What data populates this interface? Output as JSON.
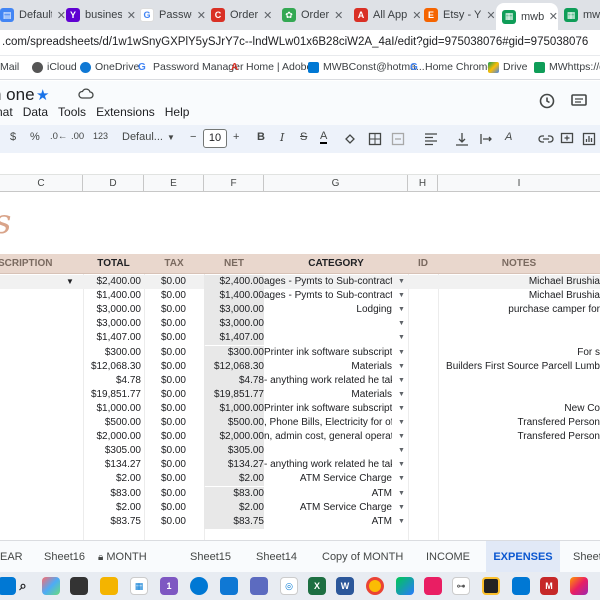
{
  "browser": {
    "tabs": [
      {
        "label": "Default",
        "icon": "google-doc-icon",
        "color": "#4285f4"
      },
      {
        "label": "business",
        "icon": "yahoo-icon",
        "color": "#6001d2"
      },
      {
        "label": "Passwo",
        "icon": "google-icon",
        "color": "#ffffff"
      },
      {
        "label": "Order",
        "icon": "order-icon",
        "color": "#d93025"
      },
      {
        "label": "Order",
        "icon": "leaf-icon",
        "color": "#34a853"
      },
      {
        "label": "All App",
        "icon": "adobe-icon",
        "color": "#d93025"
      },
      {
        "label": "Etsy - Y",
        "icon": "etsy-icon",
        "color": "#f56400"
      },
      {
        "label": "mwb b",
        "icon": "sheets-icon",
        "color": "#0f9d58"
      },
      {
        "label": "mwb",
        "icon": "sheets-icon",
        "color": "#0f9d58"
      }
    ],
    "url": ".com/spreadsheets/d/1w1wSnyGXPlY5ySJrY7c--lndWLw01x6B28ciW2A_4aI/edit?gid=975038076#gid=975038076",
    "bookmarks": [
      {
        "label": "Mail",
        "icon": "mail-icon"
      },
      {
        "label": "iCloud",
        "icon": "apple-icon"
      },
      {
        "label": "OneDrive",
        "icon": "onedrive-icon"
      },
      {
        "label": "Password Manager",
        "icon": "google-icon"
      },
      {
        "label": "Home | Adobe",
        "icon": "adobe-icon"
      },
      {
        "label": "MWBConst@hotma...",
        "icon": "outlook-icon"
      },
      {
        "label": "Home Chrome",
        "icon": "google-icon"
      },
      {
        "label": "Drive",
        "icon": "drive-icon"
      },
      {
        "label": "MWhttps://doc",
        "icon": "sheets-icon"
      }
    ]
  },
  "sheets": {
    "title": "n one",
    "menus": [
      "nat",
      "Data",
      "Tools",
      "Extensions",
      "Help"
    ],
    "toolbar": {
      "currency": "$",
      "percent": "%",
      "dec_decrease": ".0←",
      "dec_increase": ".00",
      "format_123": "123",
      "font": "Defaul...",
      "minus": "−",
      "font_size": "10",
      "plus": "+",
      "bold": "B",
      "italic": "I",
      "strike": "S",
      "text_color": "A"
    },
    "columns": [
      "C",
      "D",
      "E",
      "F",
      "G",
      "H",
      "I"
    ],
    "header_row": {
      "description": "SCRIPTION",
      "total": "TOTAL",
      "tax": "TAX",
      "net": "NET",
      "category": "CATEGORY",
      "id": "ID",
      "notes": "NOTES"
    },
    "rows": [
      {
        "total": "$2,400.00",
        "tax": "$0.00",
        "net": "$2,400.00",
        "category": "ages - Pymts to Sub-contractors",
        "notes": "Michael Brushia"
      },
      {
        "total": "$1,400.00",
        "tax": "$0.00",
        "net": "$1,400.00",
        "category": "ages - Pymts to Sub-contractors",
        "notes": "Michael Brushia"
      },
      {
        "total": "$3,000.00",
        "tax": "$0.00",
        "net": "$3,000.00",
        "category": "Lodging",
        "notes": "purchase camper for"
      },
      {
        "total": "$3,000.00",
        "tax": "$0.00",
        "net": "$3,000.00",
        "category": "",
        "notes": ""
      },
      {
        "total": "$1,407.00",
        "tax": "$0.00",
        "net": "$1,407.00",
        "category": "",
        "notes": ""
      },
      {
        "total": "$300.00",
        "tax": "$0.00",
        "net": "$300.00",
        "category": "Printer ink software subscriptions",
        "notes": "For s"
      },
      {
        "total": "$12,068.30",
        "tax": "$0.00",
        "net": "$12,068.30",
        "category": "Materials",
        "notes": "Builders First Source Parcell Lumb"
      },
      {
        "total": "$4.78",
        "tax": "$0.00",
        "net": "$4.78",
        "category": "- anything work related he takes",
        "notes": ""
      },
      {
        "total": "$19,851.77",
        "tax": "$0.00",
        "net": "$19,851.77",
        "category": "Materials",
        "notes": ""
      },
      {
        "total": "$1,000.00",
        "tax": "$0.00",
        "net": "$1,000.00",
        "category": "Printer ink software subscriptions",
        "notes": "New Co"
      },
      {
        "total": "$500.00",
        "tax": "$0.00",
        "net": "$500.00",
        "category": ", Phone Bills, Electricity for office",
        "notes": "Transfered Person"
      },
      {
        "total": "$2,000.00",
        "tax": "$0.00",
        "net": "$2,000.00",
        "category": "n, admin cost, general operation",
        "notes": "Transfered Person"
      },
      {
        "total": "$305.00",
        "tax": "$0.00",
        "net": "$305.00",
        "category": "",
        "notes": ""
      },
      {
        "total": "$134.27",
        "tax": "$0.00",
        "net": "$134.27",
        "category": "- anything work related he takes",
        "notes": ""
      },
      {
        "total": "$2.00",
        "tax": "$0.00",
        "net": "$2.00",
        "category": "ATM Service Charge",
        "notes": ""
      },
      {
        "total": "$83.00",
        "tax": "$0.00",
        "net": "$83.00",
        "category": "ATM",
        "notes": ""
      },
      {
        "total": "$2.00",
        "tax": "$0.00",
        "net": "$2.00",
        "category": "ATM Service Charge",
        "notes": ""
      },
      {
        "total": "$83.75",
        "tax": "$0.00",
        "net": "$83.75",
        "category": "ATM",
        "notes": ""
      }
    ],
    "sheet_tabs": [
      "EAR",
      "Sheet16",
      "MONTH",
      "Sheet15",
      "Sheet14",
      "Copy of MONTH",
      "INCOME",
      "EXPENSES",
      "Sheet"
    ],
    "active_sheet": "EXPENSES"
  },
  "colors": {
    "header_fill": "#e9d7cd",
    "logo": "#d9a48a",
    "active_tab": "#0b57d0"
  }
}
